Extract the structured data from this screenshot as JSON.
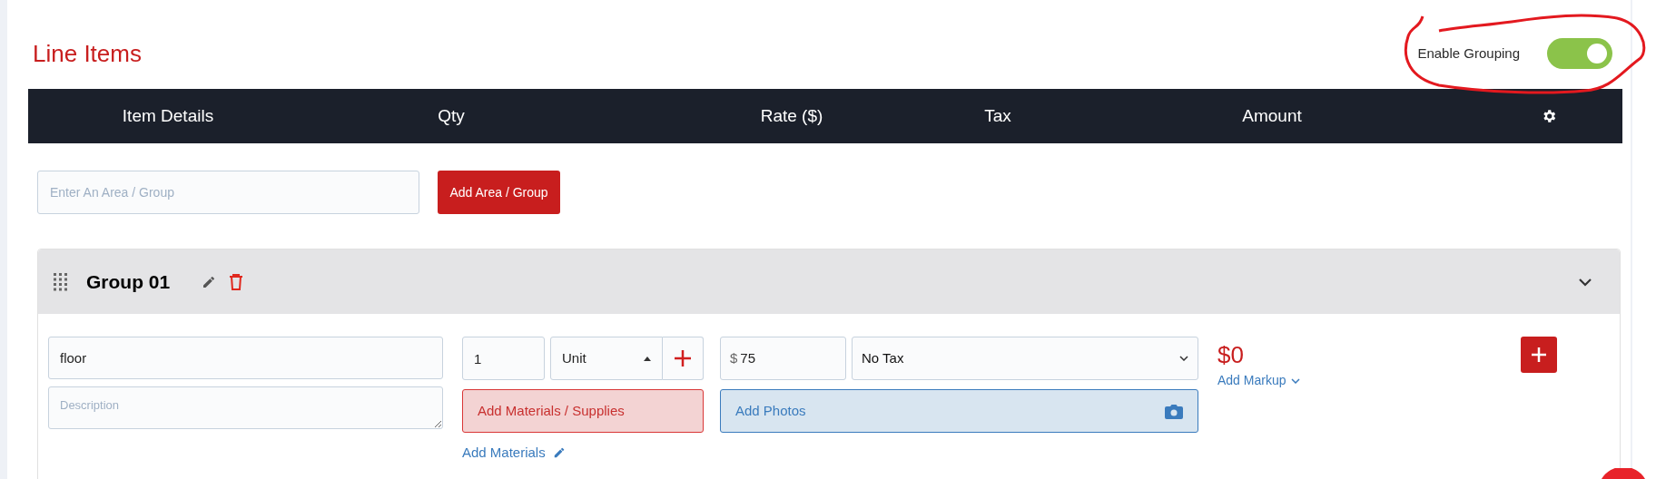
{
  "title": "Line Items",
  "grouping": {
    "label": "Enable Grouping",
    "on": true
  },
  "columns": [
    "Item Details",
    "Qty",
    "Rate ($)",
    "Tax",
    "Amount"
  ],
  "group_input": {
    "placeholder": "Enter An Area / Group"
  },
  "add_group_button": "Add Area / Group",
  "groups": [
    {
      "name": "Group 01",
      "expanded": true,
      "items": [
        {
          "name": "floor",
          "description_placeholder": "Description",
          "qty": "1",
          "unit": "Unit",
          "currency": "$",
          "rate": "75",
          "tax": "No Tax",
          "amount": "$0",
          "materials_button": "Add Materials / Supplies",
          "materials_link": "Add Materials",
          "photos_button": "Add Photos",
          "markup_link": "Add Markup"
        }
      ]
    }
  ]
}
